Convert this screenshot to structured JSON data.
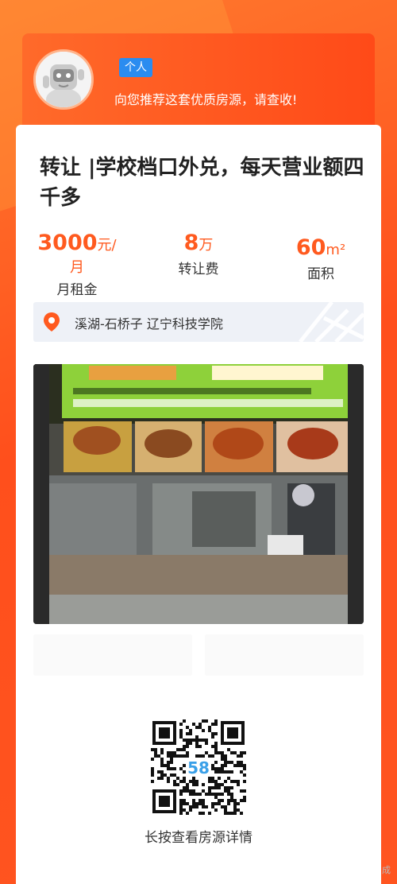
{
  "header": {
    "badge": "个人",
    "slogan": "向您推荐这套优质房源，请查收!"
  },
  "listing": {
    "title": "转让 |学校档口外兑，每天营业额四千多",
    "stats": [
      {
        "value": "3000",
        "unit": "元/月",
        "label": "月租金"
      },
      {
        "value": "8",
        "unit": "万",
        "label": "转让费"
      },
      {
        "value": "60",
        "unit": "m²",
        "label": "面积"
      }
    ],
    "address": "溪湖-石桥子 辽宁科技学院"
  },
  "qr": {
    "center_text": "58",
    "caption": "长按查看房源详情"
  },
  "watermark": "成",
  "colors": {
    "accent": "#ff5a1f",
    "badge": "#2a8cf0"
  },
  "icons": {
    "avatar": "robot-mascot-icon",
    "pin": "location-pin-icon"
  }
}
